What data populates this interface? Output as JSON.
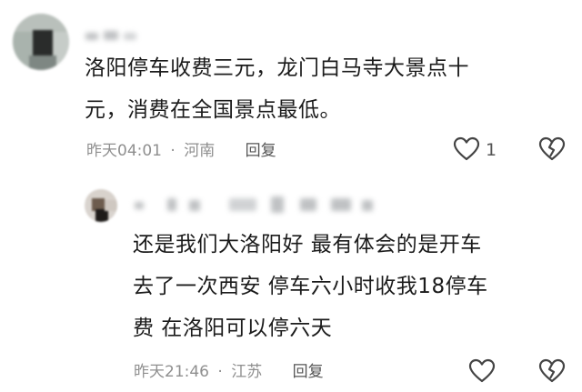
{
  "comments": [
    {
      "text_lines": [
        "洛阳停车收费三元，龙门白马寺大景点十",
        "元，消费在全国景点最低。"
      ],
      "time": "昨天04:01",
      "separator": "·",
      "location": "河南",
      "reply_label": "回复",
      "like_count": "1",
      "icons": {
        "like": "heart-outline-icon",
        "dislike": "broken-heart-icon"
      }
    },
    {
      "text_lines": [
        "还是我们大洛阳好  最有体会的是开车",
        "去了一次西安  停车六小时收我18停车",
        "费  在洛阳可以停六天"
      ],
      "time": "昨天21:46",
      "separator": "·",
      "location": "江苏",
      "reply_label": "回复",
      "icons": {
        "like": "heart-outline-icon",
        "dislike": "broken-heart-icon"
      }
    }
  ],
  "colors": {
    "text": "#1b1b1b",
    "meta": "#8f8f8f",
    "icon": "#444444"
  }
}
